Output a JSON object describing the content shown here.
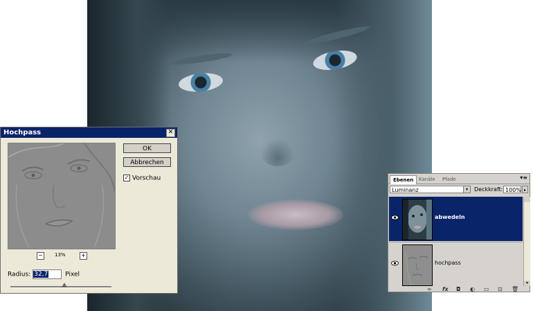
{
  "dialog": {
    "title": "Hochpass",
    "close_glyph": "✕",
    "ok_label": "OK",
    "cancel_label": "Abbrechen",
    "preview_checkbox_label": "Vorschau",
    "preview_checked": true,
    "checkbox_glyph": "✓",
    "zoom_minus": "−",
    "zoom_plus": "+",
    "zoom_level": "13%",
    "radius_label": "Radius:",
    "radius_value": "32,7",
    "radius_unit": "Pixel"
  },
  "layers_panel": {
    "tabs": [
      "Ebenen",
      "Kanäle",
      "Pfade"
    ],
    "active_tab": "Ebenen",
    "menu_glyph": "▾≡",
    "blend_mode": "Luminanz",
    "opacity_label": "Deckkraft:",
    "opacity_value": "100%",
    "dropdown_glyph": "▾",
    "opacity_arrow_glyph": "▸",
    "layers": [
      {
        "name": "abwedeln",
        "selected": true,
        "visible": true
      },
      {
        "name": "hochpass",
        "selected": false,
        "visible": true
      }
    ],
    "bottom_icons": [
      "link-icon",
      "fx-icon",
      "mask-icon",
      "adjustment-icon",
      "group-icon",
      "new-layer-icon",
      "trash-icon"
    ],
    "bottom_glyphs": [
      "∞",
      "fx",
      "◘",
      "◐",
      "▭",
      "⊡",
      "🗑"
    ]
  },
  "colors": {
    "title_bar": "#0a246a",
    "selected_layer": "#0a246a",
    "dialog_bg": "#ece9d8"
  }
}
